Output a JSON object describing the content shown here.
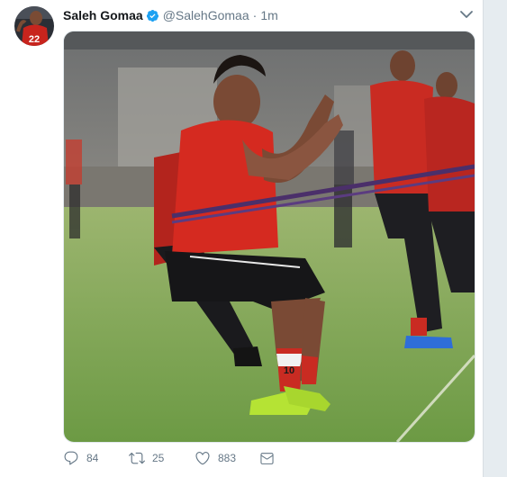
{
  "tweet": {
    "display_name": "Saleh Gomaa",
    "handle": "@SalehGomaa",
    "separator": "·",
    "timestamp": "1m",
    "avatar_jersey_number": "22",
    "media": {
      "jersey_number": "10",
      "icon": "photo-football-training"
    },
    "stats": {
      "replies": "84",
      "retweets": "25",
      "likes": "883"
    }
  },
  "colors": {
    "name": "#14171a",
    "muted": "#657786",
    "verified": "#1da1f2",
    "jersey_red": "#d4281f",
    "pitch_green": "#7fa553"
  }
}
